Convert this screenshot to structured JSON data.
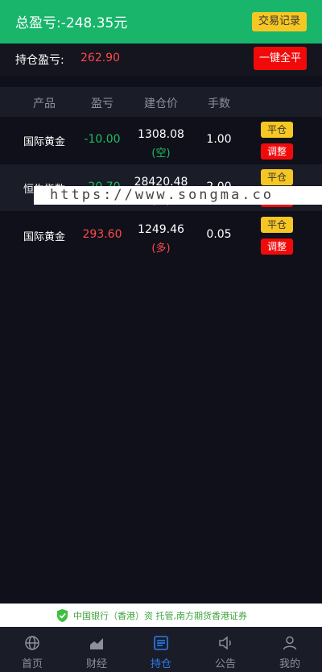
{
  "header": {
    "total_label": "总盈亏:-248.35元",
    "records_button": "交易记录"
  },
  "holding": {
    "label": "持仓盈亏:",
    "value": "262.90",
    "close_all_button": "一键全平"
  },
  "table": {
    "columns": [
      "产品",
      "盈亏",
      "建仓价",
      "手数"
    ],
    "rows": [
      {
        "name": "国际黄金",
        "pnl": "-10.00",
        "price": "1308.08",
        "dir": "(空)",
        "qty": "1.00",
        "close": "平仓",
        "adjust": "调整"
      },
      {
        "name": "恒生指数",
        "pnl": "-20.70",
        "price": "28420.48",
        "dir": "(多)",
        "qty": "2.00",
        "close": "平仓",
        "adjust": "调整"
      },
      {
        "name": "国际黄金",
        "pnl": "293.60",
        "price": "1249.46",
        "dir": "(多)",
        "qty": "0.05",
        "close": "平仓",
        "adjust": "调整"
      }
    ]
  },
  "watermark": "https://www.songma.co",
  "footer_note": "中国银行（香港）资  托管,南方期货香港证券",
  "tabs": [
    {
      "label": "首页",
      "icon": "globe-icon"
    },
    {
      "label": "财经",
      "icon": "chart-icon"
    },
    {
      "label": "持仓",
      "icon": "position-icon"
    },
    {
      "label": "公告",
      "icon": "speaker-icon"
    },
    {
      "label": "我的",
      "icon": "user-icon"
    }
  ],
  "colors": {
    "brand": "#18b56a",
    "accent": "#2d7cf0",
    "profit": "#ff4a4a",
    "loss": "#1fbf63"
  }
}
